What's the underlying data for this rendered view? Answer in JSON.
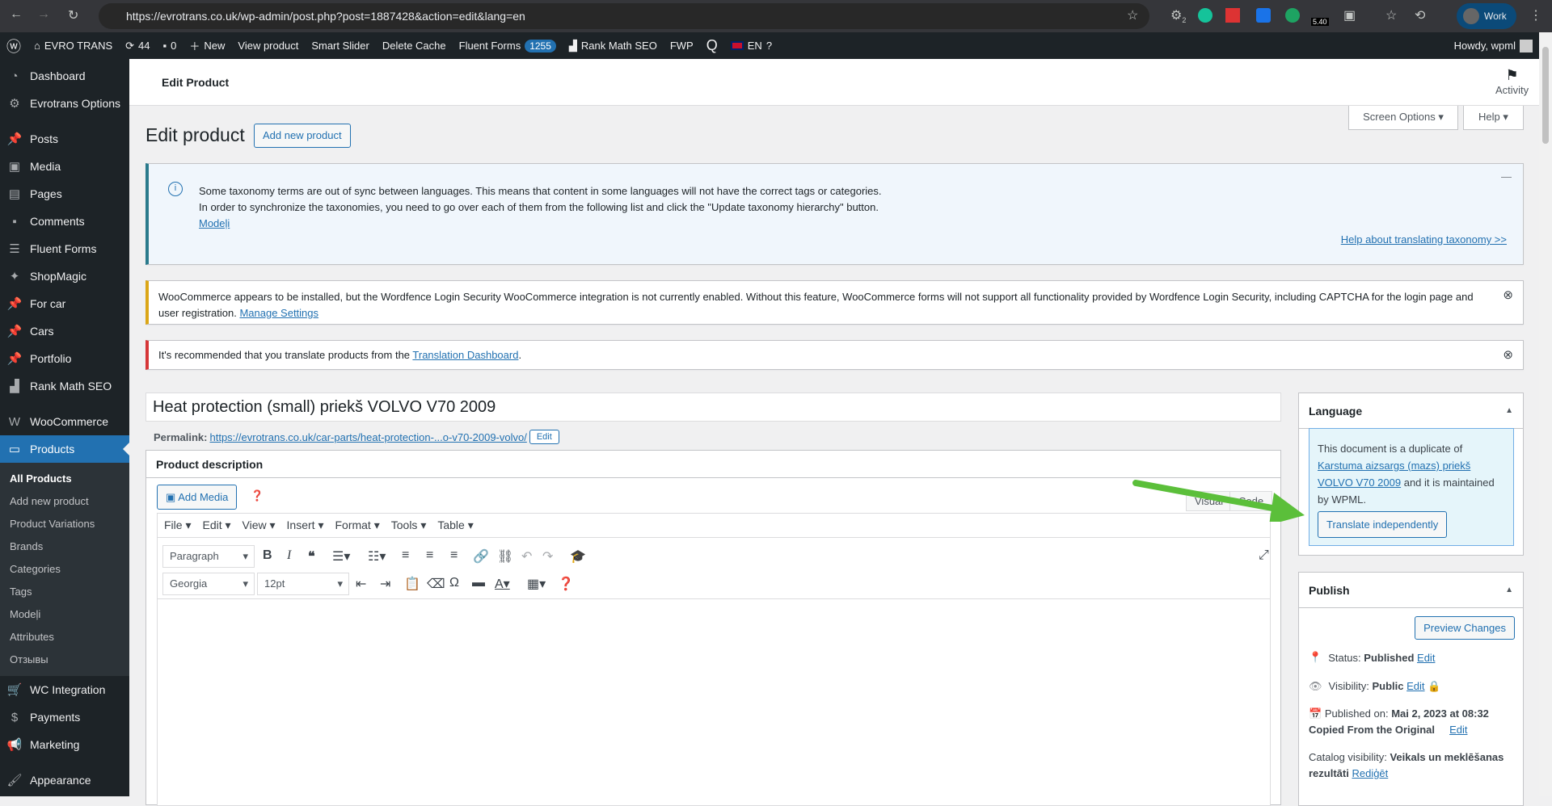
{
  "browser": {
    "url": "https://evrotrans.co.uk/wp-admin/post.php?post=1887428&action=edit&lang=en",
    "profile": "Work",
    "ext_badge": "2",
    "ext_version": "5.40"
  },
  "adminbar": {
    "site": "EVRO TRANS",
    "updates": "44",
    "comments": "0",
    "new": "New",
    "view": "View product",
    "slider": "Smart Slider",
    "cache": "Delete Cache",
    "forms": "Fluent Forms",
    "forms_count": "1255",
    "seo": "Rank Math SEO",
    "fwp": "FWP",
    "lang": "EN",
    "howdy": "Howdy, wpml"
  },
  "sidebar": {
    "items": [
      {
        "label": "Dashboard",
        "icon": "dashboard-icon"
      },
      {
        "label": "Evrotrans Options",
        "icon": "gear-icon"
      },
      {
        "label": "Posts",
        "icon": "pin-icon"
      },
      {
        "label": "Media",
        "icon": "media-icon"
      },
      {
        "label": "Pages",
        "icon": "pages-icon"
      },
      {
        "label": "Comments",
        "icon": "comment-icon"
      },
      {
        "label": "Fluent Forms",
        "icon": "forms-icon"
      },
      {
        "label": "ShopMagic",
        "icon": "wand-icon"
      },
      {
        "label": "For car",
        "icon": "pin-icon"
      },
      {
        "label": "Cars",
        "icon": "pin-icon"
      },
      {
        "label": "Portfolio",
        "icon": "pin-icon"
      },
      {
        "label": "Rank Math SEO",
        "icon": "chart-icon"
      },
      {
        "label": "WooCommerce",
        "icon": "woo-icon"
      },
      {
        "label": "Products",
        "icon": "archive-icon"
      }
    ],
    "sub": [
      "All Products",
      "Add new product",
      "Product Variations",
      "Brands",
      "Categories",
      "Tags",
      "Modeļi",
      "Attributes",
      "Отзывы"
    ],
    "after": [
      {
        "label": "WC Integration",
        "icon": "cart-icon"
      },
      {
        "label": "Payments",
        "icon": "money-icon"
      },
      {
        "label": "Marketing",
        "icon": "megaphone-icon"
      },
      {
        "label": "Appearance",
        "icon": "brush-icon"
      }
    ]
  },
  "header": {
    "title": "Edit Product",
    "activity": "Activity"
  },
  "page": {
    "title": "Edit product",
    "add_new": "Add new product",
    "screen_options": "Screen Options",
    "help": "Help"
  },
  "notices": {
    "taxonomy": {
      "line1": "Some taxonomy terms are out of sync between languages. This means that content in some languages will not have the correct tags or categories.",
      "line2": "In order to synchronize the taxonomies, you need to go over each of them from the following list and click the \"Update taxonomy hierarchy\" button.",
      "link": "Modeļi",
      "help": "Help about translating taxonomy >>"
    },
    "wordfence": {
      "text": "WooCommerce appears to be installed, but the Wordfence Login Security WooCommerce integration is not currently enabled. Without this feature, WooCommerce forms will not support all functionality provided by Wordfence Login Security, including CAPTCHA for the login page and user registration.",
      "link": "Manage Settings"
    },
    "translate": {
      "text": "It's recommended that you translate products from the ",
      "link": "Translation Dashboard",
      "end": "."
    }
  },
  "post": {
    "title": "Heat protection (small) priekš VOLVO V70 2009",
    "permalink_label": "Permalink:",
    "permalink": "https://evrotrans.co.uk/car-parts/heat-protection-...o-v70-2009-volvo/",
    "edit": "Edit"
  },
  "editor": {
    "box_title": "Product description",
    "add_media": "Add Media",
    "visual": "Visual",
    "code": "Code",
    "menus": [
      "File",
      "Edit",
      "View",
      "Insert",
      "Format",
      "Tools",
      "Table"
    ],
    "format": "Paragraph",
    "font": "Georgia",
    "size": "12pt"
  },
  "language": {
    "title": "Language",
    "text1": "This document is a duplicate of ",
    "link": "Karstuma aizsargs (mazs) priekš VOLVO V70 2009",
    "text2": " and it is maintained by WPML.",
    "button": "Translate independently"
  },
  "publish": {
    "title": "Publish",
    "preview": "Preview Changes",
    "status_label": "Status:",
    "status": "Published",
    "visibility_label": "Visibility:",
    "visibility": "Public",
    "published_label": "Published on:",
    "published": "Mai 2, 2023 at 08:32",
    "copied": "Copied From the Original",
    "edit": "Edit",
    "catalog_label": "Catalog visibility:",
    "catalog": "Veikals un meklēšanas rezultāti",
    "catalog_edit": "Rediģēt"
  },
  "colors": {
    "accent": "#2271b1",
    "arrow": "#5bbf3a"
  }
}
